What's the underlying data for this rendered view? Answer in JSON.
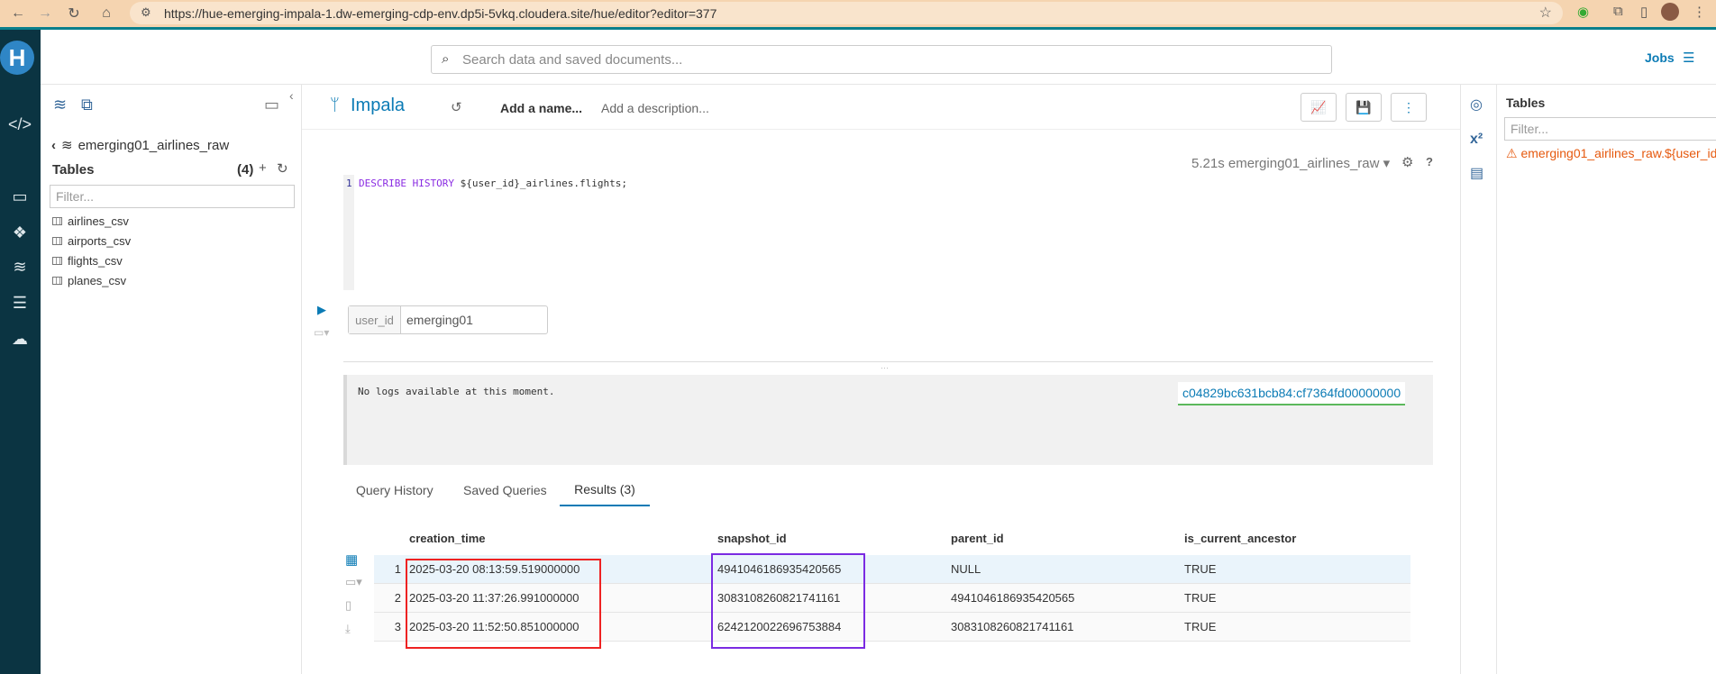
{
  "browser": {
    "url": "https://hue-emerging-impala-1.dw-emerging-cdp-env.dp5i-5vkq.cloudera.site/hue/editor?editor=377"
  },
  "search": {
    "placeholder": "Search data and saved documents..."
  },
  "header": {
    "jobs_label": "Jobs"
  },
  "assist": {
    "database": "emerging01_airlines_raw",
    "tables_label": "Tables",
    "tables_count": "(4)",
    "filter_placeholder": "Filter...",
    "tables": [
      "airlines_csv",
      "airports_csv",
      "flights_csv",
      "planes_csv"
    ]
  },
  "editor": {
    "dialect": "Impala",
    "add_name": "Add a name...",
    "add_description": "Add a description...",
    "exec_time": "5.21s",
    "exec_db": "emerging01_airlines_raw",
    "line_number": "1",
    "code_keyword": "DESCRIBE HISTORY",
    "code_rest": " ${user_id}_airlines.flights;",
    "variable_name": "user_id",
    "variable_value": "emerging01",
    "logs_text": "No logs available at this moment.",
    "query_id": "c04829bc631bcb84:cf7364fd00000000"
  },
  "tabs": {
    "query_history": "Query History",
    "saved_queries": "Saved Queries",
    "results": "Results (3)"
  },
  "results": {
    "columns": [
      "creation_time",
      "snapshot_id",
      "parent_id",
      "is_current_ancestor"
    ],
    "rows": [
      [
        "1",
        "2025-03-20 08:13:59.519000000",
        "4941046186935420565",
        "NULL",
        "TRUE"
      ],
      [
        "2",
        "2025-03-20 11:37:26.991000000",
        "3083108260821741161",
        "4941046186935420565",
        "TRUE"
      ],
      [
        "3",
        "2025-03-20 11:52:50.851000000",
        "6242120022696753884",
        "3083108260821741161",
        "TRUE"
      ]
    ]
  },
  "right_panel": {
    "title": "Tables",
    "filter_placeholder": "Filter...",
    "warning": "emerging01_airlines_raw.${user_id"
  },
  "colors": {
    "accent": "#0b7bb5",
    "sidebar": "#0b3442",
    "highlight_red": "#ee2222",
    "highlight_purple": "#7b2be2",
    "warning": "#e6590e"
  }
}
